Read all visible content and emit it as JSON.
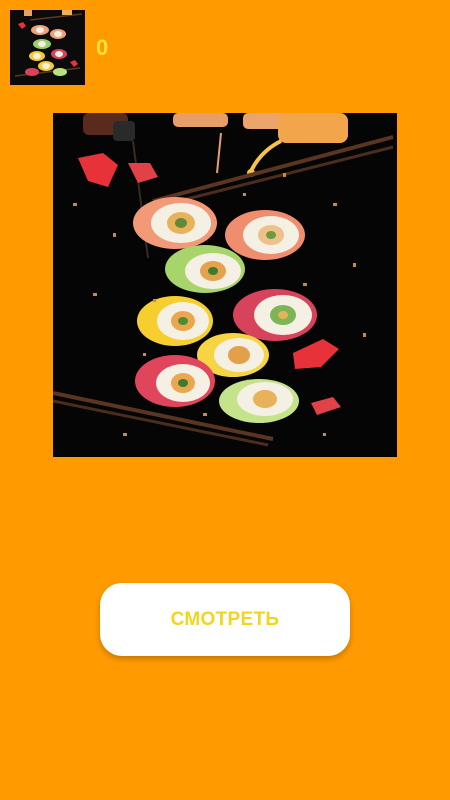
{
  "score": {
    "value": "0"
  },
  "thumbnail": {
    "subject": "sushi-rolls-image"
  },
  "main_image": {
    "subject": "flying-sushi-rolls-with-chopsticks-and-sauce-bottles"
  },
  "watch_button": {
    "label": "СМОТРЕТЬ"
  },
  "colors": {
    "background": "#FF9A00",
    "score_text": "#FFE23A",
    "button_bg": "#FFFFFF",
    "button_text": "#F2D51F"
  }
}
